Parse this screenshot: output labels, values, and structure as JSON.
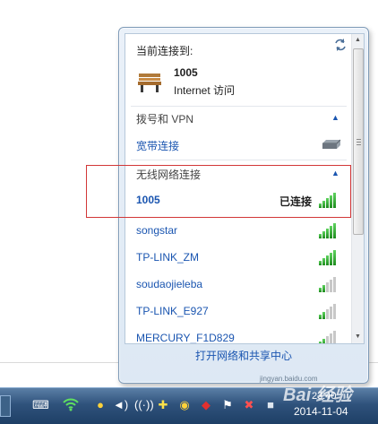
{
  "flyout": {
    "current_connection_label": "当前连接到:",
    "current_network_name": "1005",
    "current_network_access": "Internet 访问",
    "dialup_section_title": "拨号和 VPN",
    "broadband_label": "宽带连接",
    "wireless_section_title": "无线网络连接",
    "networks": [
      {
        "name": "1005",
        "status": "已连接",
        "signal": 5
      },
      {
        "name": "songstar",
        "status": "",
        "signal": 5
      },
      {
        "name": "TP-LINK_ZM",
        "status": "",
        "signal": 5
      },
      {
        "name": "soudaojieleba",
        "status": "",
        "signal": 2
      },
      {
        "name": "TP-LINK_E927",
        "status": "",
        "signal": 2
      },
      {
        "name": "MERCURY_F1D829",
        "status": "",
        "signal": 2
      }
    ],
    "footer_link": "打开网络和共享中心"
  },
  "taskbar": {
    "time": "23:40",
    "date": "2014-11-04",
    "tray_icons": [
      "keyboard-icon",
      "wifi-icon",
      "paw-icon",
      "volume-icon",
      "network-activity-icon",
      "plus-icon",
      "qq-icon",
      "red-app-icon",
      "flag-icon",
      "red-x-icon",
      "shield-icon",
      "signal-icon"
    ]
  },
  "watermark": {
    "logo": "Bai 经验",
    "url": "jingyan.baidu.com"
  },
  "colors": {
    "link": "#1a55b0",
    "highlight_box": "#d23737",
    "signal_green": "#2ea52e",
    "taskbar": "#2f527c"
  }
}
